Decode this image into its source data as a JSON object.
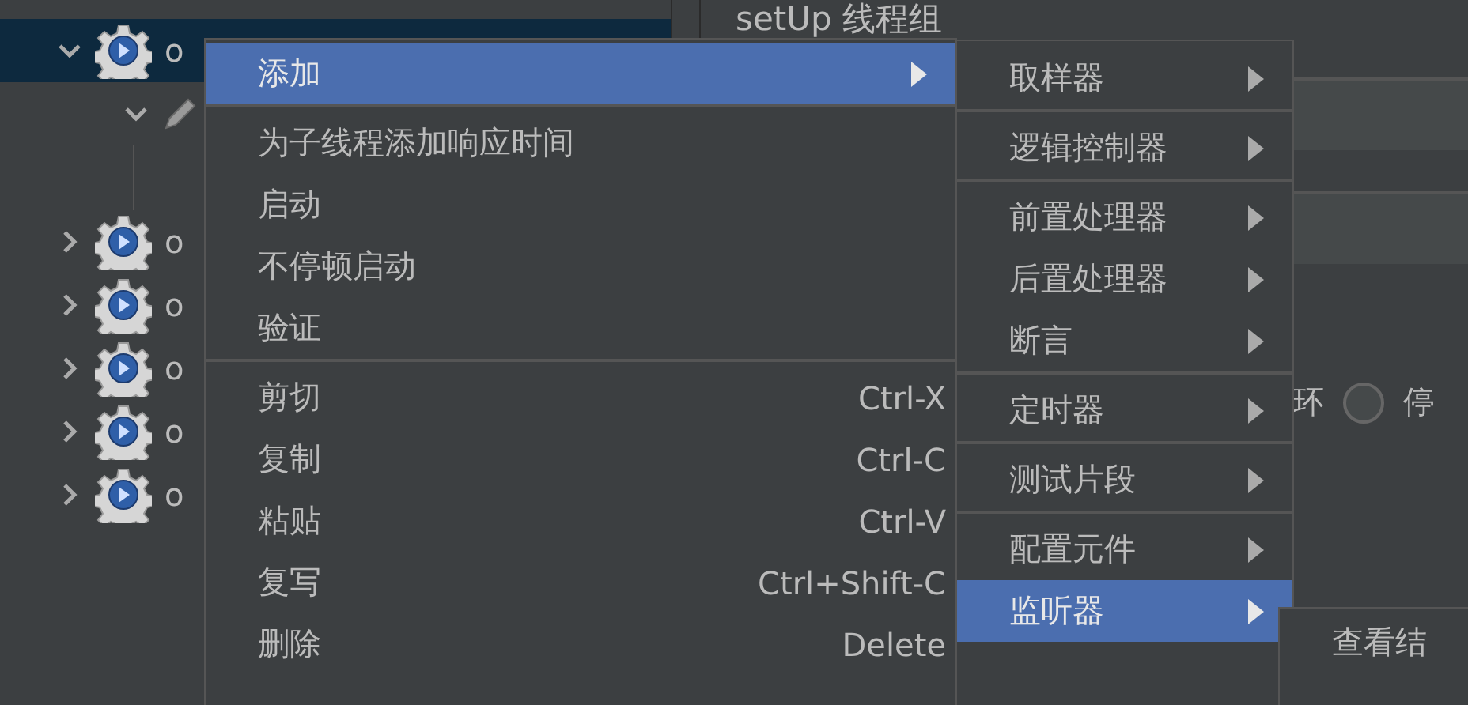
{
  "tree": {
    "items": [
      {
        "label": "o",
        "expanded": true,
        "selected": true,
        "kind": "thread-group",
        "children": [
          {
            "kind": "pencil",
            "expanded": true
          }
        ]
      },
      {
        "label": "o",
        "expanded": false,
        "selected": false,
        "kind": "thread-group"
      },
      {
        "label": "o",
        "expanded": false,
        "selected": false,
        "kind": "thread-group"
      },
      {
        "label": "o",
        "expanded": false,
        "selected": false,
        "kind": "thread-group"
      },
      {
        "label": "o",
        "expanded": false,
        "selected": false,
        "kind": "thread-group"
      },
      {
        "label": "o",
        "expanded": false,
        "selected": false,
        "kind": "thread-group"
      }
    ]
  },
  "panel": {
    "title": "setUp 线程组",
    "option_tail": "环",
    "radio": {
      "label": "停",
      "selected": false
    }
  },
  "context_menu": {
    "items": [
      {
        "label": "添加",
        "submenu": true,
        "selected": true,
        "separator_before": false
      },
      {
        "label": "为子线程添加响应时间",
        "submenu": false,
        "selected": false,
        "separator_before": true
      },
      {
        "label": "启动",
        "submenu": false,
        "selected": false,
        "separator_before": false
      },
      {
        "label": "不停顿启动",
        "submenu": false,
        "selected": false,
        "separator_before": false
      },
      {
        "label": "验证",
        "submenu": false,
        "selected": false,
        "separator_before": false
      },
      {
        "label": "剪切",
        "shortcut": "Ctrl-X",
        "submenu": false,
        "selected": false,
        "separator_before": true
      },
      {
        "label": "复制",
        "shortcut": "Ctrl-C",
        "submenu": false,
        "selected": false,
        "separator_before": false
      },
      {
        "label": "粘贴",
        "shortcut": "Ctrl-V",
        "submenu": false,
        "selected": false,
        "separator_before": false
      },
      {
        "label": "复写",
        "shortcut": "Ctrl+Shift-C",
        "submenu": false,
        "selected": false,
        "separator_before": false
      },
      {
        "label": "删除",
        "shortcut": "Delete",
        "submenu": false,
        "selected": false,
        "separator_before": false
      }
    ]
  },
  "add_submenu": {
    "items": [
      {
        "label": "取样器",
        "submenu": true,
        "selected": false,
        "separator_before": false
      },
      {
        "label": "逻辑控制器",
        "submenu": true,
        "selected": false,
        "separator_before": true
      },
      {
        "label": "前置处理器",
        "submenu": true,
        "selected": false,
        "separator_before": true
      },
      {
        "label": "后置处理器",
        "submenu": true,
        "selected": false,
        "separator_before": false
      },
      {
        "label": "断言",
        "submenu": true,
        "selected": false,
        "separator_before": false
      },
      {
        "label": "定时器",
        "submenu": true,
        "selected": false,
        "separator_before": true
      },
      {
        "label": "测试片段",
        "submenu": true,
        "selected": false,
        "separator_before": true
      },
      {
        "label": "配置元件",
        "submenu": true,
        "selected": false,
        "separator_before": true
      },
      {
        "label": "监听器",
        "submenu": true,
        "selected": true,
        "separator_before": false
      }
    ]
  },
  "listener_submenu": {
    "items": [
      {
        "label": "查看结",
        "submenu": false,
        "selected": false,
        "separator_before": false
      }
    ]
  }
}
